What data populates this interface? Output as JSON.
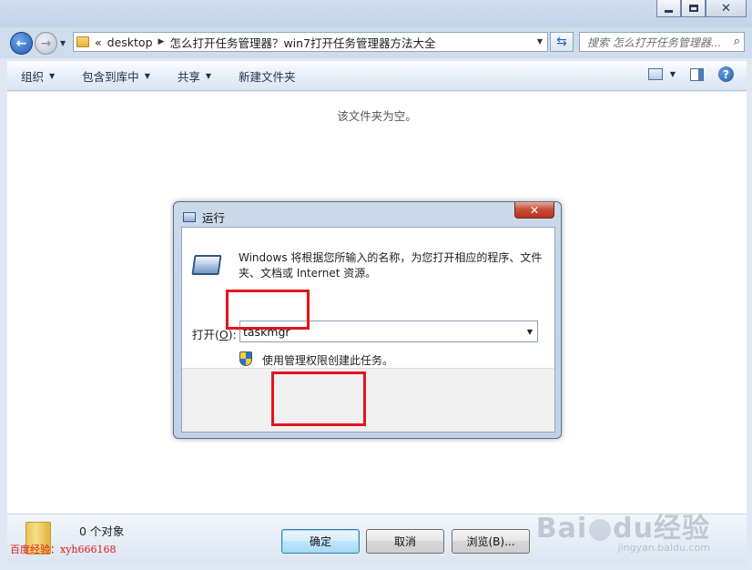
{
  "explorer": {
    "address": {
      "chevrons": "«",
      "crumb_1": "desktop",
      "crumb_2": "怎么打开任务管理器？win7打开任务管理器方法大全"
    },
    "search_placeholder": "搜索 怎么打开任务管理器...",
    "toolbar": {
      "organize": "组织",
      "include_in_library": "包含到库中",
      "share": "共享",
      "new_folder": "新建文件夹"
    },
    "empty_message": "该文件夹为空。",
    "status_count": "0 个对象"
  },
  "run_dialog": {
    "title": "运行",
    "description": "Windows 将根据您所输入的名称，为您打开相应的程序、文件夹、文档或 Internet 资源。",
    "open_label_prefix": "打开(",
    "open_label_key": "O",
    "open_label_suffix": "):",
    "input_value": "taskmgr",
    "admin_text": "使用管理权限创建此任务。",
    "buttons": {
      "ok": "确定",
      "cancel": "取消",
      "browse": "浏览(B)..."
    }
  },
  "watermarks": {
    "left": "百度经验：xyh666168",
    "right_big_a": "Bai",
    "right_big_b": "du经验",
    "right_small": "jingyan.baidu.com"
  },
  "colors": {
    "highlight": "#e4141d",
    "explorer_chrome": "#cfdcec",
    "watermark_left": "#e01616"
  },
  "icons": [
    "back-arrow-icon",
    "forward-arrow-icon",
    "folder-icon",
    "refresh-icon",
    "search-icon",
    "view-options-icon",
    "preview-pane-icon",
    "help-icon",
    "run-icon",
    "uac-shield-icon",
    "close-icon",
    "minimize-icon",
    "maximize-icon"
  ]
}
